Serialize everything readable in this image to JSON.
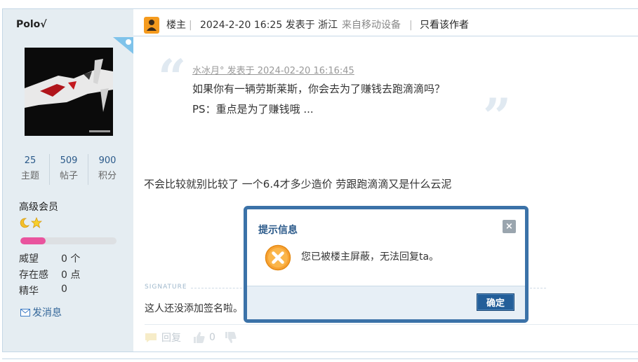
{
  "author": {
    "name": "Polo√",
    "stats": [
      {
        "num": "25",
        "label": "主题"
      },
      {
        "num": "509",
        "label": "帖子"
      },
      {
        "num": "900",
        "label": "积分"
      }
    ],
    "level": "高级会员",
    "progress": 0.26,
    "props": [
      {
        "key": "威望",
        "value": "0 个"
      },
      {
        "key": "存在感",
        "value": "0 点"
      },
      {
        "key": "精华",
        "value": "0"
      }
    ],
    "message_link": "发消息"
  },
  "post": {
    "role": "楼主",
    "sep1": "|",
    "datetime": "2024-2-20 16:25 发表于 浙江",
    "device": "来自移动设备",
    "sep2": "|",
    "author_only": "只看该作者",
    "quote": {
      "meta": "水冰月° 发表于 2024-02-20 16:16:45",
      "line1": "如果你有一辆劳斯莱斯，你会去为了赚钱去跑滴滴吗？",
      "line2": "PS：重点是为了赚钱哦 ..."
    },
    "body": "不会比较就别比较了 一个6.4才多少造价 劳跟跑滴滴又是什么云泥",
    "signature_label": "SIGNATURE",
    "signature": "这人还没添加签名啦。",
    "reply_label": "回复",
    "like_count": "0"
  },
  "dialog": {
    "title": "提示信息",
    "close": "×",
    "message": "您已被楼主屏蔽，无法回复ta。",
    "ok": "确定"
  },
  "colors": {
    "accent": "#3b72a8",
    "sidebar_bg": "#e5edf2",
    "progress": "#e9549e",
    "warning": "#f7a233"
  }
}
